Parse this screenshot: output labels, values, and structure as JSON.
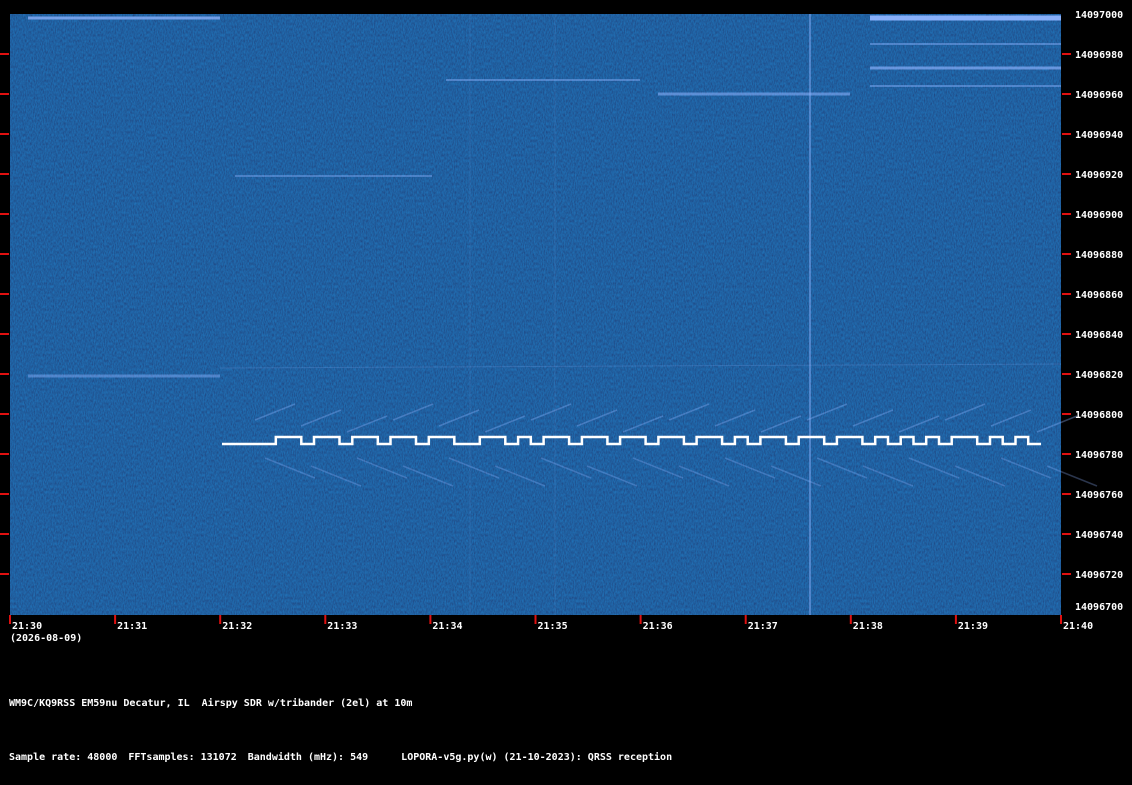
{
  "freq_labels": [
    "14097000",
    "14096980",
    "14096960",
    "14096940",
    "14096920",
    "14096900",
    "14096880",
    "14096860",
    "14096840",
    "14096820",
    "14096800",
    "14096780",
    "14096760",
    "14096740",
    "14096720",
    "14096700"
  ],
  "time_labels": [
    "21:30",
    "21:31",
    "21:32",
    "21:33",
    "21:34",
    "21:35",
    "21:36",
    "21:37",
    "21:38",
    "21:39",
    "21:40"
  ],
  "date_label": "(2026-08-09)",
  "footer": {
    "station": "WM9C/KQ9RSS EM59nu Decatur, IL  Airspy SDR w/tribander (2el) at 10m",
    "sample_rate": "Sample rate: 48000",
    "fft_samples": "FFTsamples: 131072",
    "bandwidth": "Bandwidth (mHz): 549",
    "software": "LOPORA-v5g.py(w) (21-10-2023): QRSS reception"
  },
  "colors": {
    "background": "#0a1a4a",
    "tick": "#e01010",
    "signal": "#ffffff",
    "text": "#ffffff"
  }
}
